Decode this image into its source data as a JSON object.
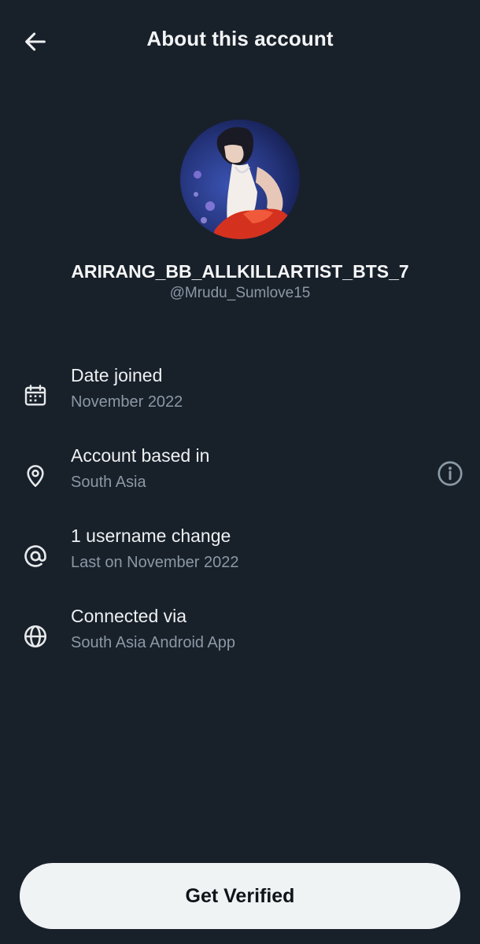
{
  "header": {
    "title": "About this account",
    "back_icon": "arrow-left-icon"
  },
  "profile": {
    "display_name": "ARIRANG_BB_ALLKILLARTIST_BTS_7",
    "handle": "@Mrudu_Sumlove15"
  },
  "info": [
    {
      "icon": "calendar-icon",
      "title": "Date joined",
      "subtitle": "November 2022"
    },
    {
      "icon": "location-pin-icon",
      "title": "Account based in",
      "subtitle": "South Asia",
      "action_icon": "info-icon"
    },
    {
      "icon": "at-sign-icon",
      "title": "1 username change",
      "subtitle": "Last on November 2022"
    },
    {
      "icon": "globe-icon",
      "title": "Connected via",
      "subtitle": "South Asia Android App"
    }
  ],
  "footer": {
    "button_label": "Get Verified"
  },
  "colors": {
    "background": "#18202a",
    "text_primary": "#e7e9ea",
    "text_secondary": "#8b98a5",
    "button_bg": "#eff3f4",
    "button_text": "#0f1419"
  }
}
